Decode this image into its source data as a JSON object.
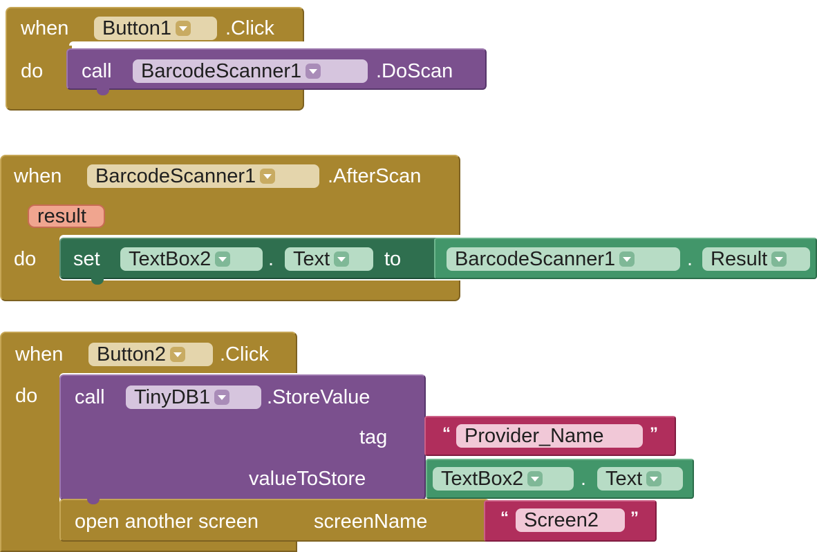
{
  "block1": {
    "when_label": "when",
    "component": "Button1",
    "event": ".Click",
    "do_label": "do",
    "call_label": "call",
    "call_component": "BarcodeScanner1",
    "method": ".DoScan"
  },
  "block2": {
    "when_label": "when",
    "component": "BarcodeScanner1",
    "event": ".AfterScan",
    "param": "result",
    "do_label": "do",
    "set_label": "set",
    "set_component": "TextBox2",
    "dot1": ".",
    "property": "Text",
    "to_label": "to",
    "value_component": "BarcodeScanner1",
    "dot2": ".",
    "value_property": "Result"
  },
  "block3": {
    "when_label": "when",
    "component": "Button2",
    "event": ".Click",
    "do_label": "do",
    "call_label": "call",
    "call_component": "TinyDB1",
    "method": ".StoreValue",
    "tag_label": "tag",
    "tag_value": "Provider_Name",
    "value_to_store_label": "valueToStore",
    "store_component": "TextBox2",
    "store_dot": ".",
    "store_property": "Text",
    "open_label": "open another screen",
    "screen_name_label": "screenName",
    "screen_name_value": "Screen2",
    "open_quote": "“",
    "close_quote": "”"
  },
  "colors": {
    "event_gold": "#a8862f",
    "procedure_purple": "#7b508e",
    "setter_dark_green": "#2f6f4f",
    "getter_green": "#42966a",
    "text_magenta": "#b02e5c",
    "param_salmon": "#f0a58f"
  },
  "icons": {
    "dropdown": "chevron-down-icon"
  }
}
